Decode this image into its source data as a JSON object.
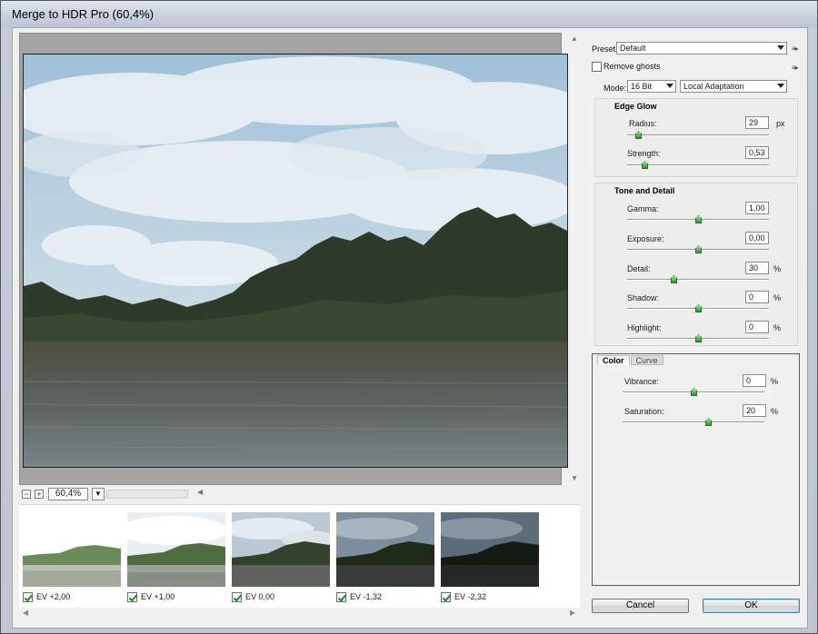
{
  "window": {
    "title": "Merge to HDR Pro (60,4%)"
  },
  "preview": {
    "zoom_value": "60,4%",
    "zoom_out_icon": "minus-icon",
    "zoom_in_icon": "plus-icon"
  },
  "thumbnails": [
    {
      "label": "EV +2,00",
      "checked": true,
      "tone": "very-bright"
    },
    {
      "label": "EV +1,00",
      "checked": true,
      "tone": "bright"
    },
    {
      "label": "EV 0,00",
      "checked": true,
      "tone": "normal"
    },
    {
      "label": "EV -1,32",
      "checked": true,
      "tone": "dark"
    },
    {
      "label": "EV -2,32",
      "checked": true,
      "tone": "very-dark"
    }
  ],
  "panel": {
    "preset_label": "Preset:",
    "preset_value": "Default",
    "remove_ghosts_label": "Remove ghosts",
    "remove_ghosts_checked": false,
    "mode_label": "Mode:",
    "bit_depth": "16 Bit",
    "method": "Local Adaptation",
    "edge_glow": {
      "title": "Edge Glow",
      "radius": {
        "label": "Radius:",
        "value": "29",
        "unit": "px",
        "level": 0.08
      },
      "strength": {
        "label": "Strength:",
        "value": "0,53",
        "unit": "",
        "level": 0.12
      }
    },
    "tone_detail": {
      "title": "Tone and Detail",
      "gamma": {
        "label": "Gamma:",
        "value": "1,00",
        "unit": "",
        "level": 0.5
      },
      "exposure": {
        "label": "Exposure:",
        "value": "0,00",
        "unit": "",
        "level": 0.5
      },
      "detail": {
        "label": "Detail:",
        "value": "30",
        "unit": "%",
        "level": 0.33
      },
      "shadow": {
        "label": "Shadow:",
        "value": "0",
        "unit": "%",
        "level": 0.5
      },
      "highlight": {
        "label": "Highlight:",
        "value": "0",
        "unit": "%",
        "level": 0.5
      }
    },
    "tabs": [
      "Color",
      "Curve"
    ],
    "active_tab": "Color",
    "color": {
      "vibrance": {
        "label": "Vibrance:",
        "value": "0",
        "unit": "%",
        "level": 0.5
      },
      "saturation": {
        "label": "Saturation:",
        "value": "20",
        "unit": "%",
        "level": 0.6
      }
    }
  },
  "buttons": {
    "cancel": "Cancel",
    "ok": "OK"
  },
  "colors": {
    "accent_knob": "#2a9a2a",
    "check": "#1e8a1e"
  }
}
